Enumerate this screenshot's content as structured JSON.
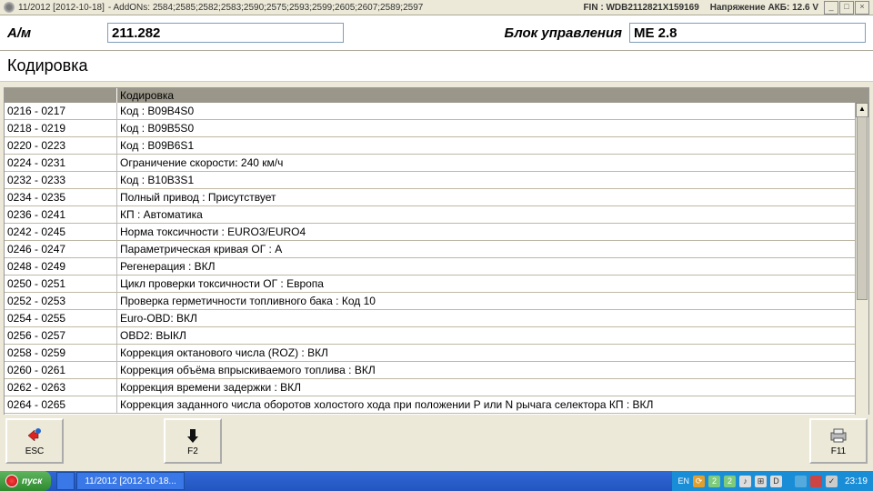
{
  "titlebar": {
    "version": "11/2012 [2012-10-18]",
    "addons": "- AddONs: 2584;2585;2582;2583;2590;2575;2593;2599;2605;2607;2589;2597",
    "finlabel": "FIN :",
    "fin": "WDB2112821X159169",
    "voltlabel": "Напряжение АКБ:",
    "volt": "12.6 V"
  },
  "header": {
    "amlabel": "А/м",
    "am": "211.282",
    "eculabel": "Блок управления",
    "ecu": "ME 2.8"
  },
  "subtitle": "Кодировка",
  "cols": {
    "c1": "",
    "c2": "Кодировка"
  },
  "rows": [
    {
      "id": "0216 - 0217",
      "val": "Код : B09B4S0"
    },
    {
      "id": "0218 - 0219",
      "val": "Код : B09B5S0"
    },
    {
      "id": "0220 - 0223",
      "val": "Код : B09B6S1"
    },
    {
      "id": "0224 - 0231",
      "val": "Ограничение скорости: 240 км/ч"
    },
    {
      "id": "0232 - 0233",
      "val": "Код : B10B3S1"
    },
    {
      "id": "0234 - 0235",
      "val": "Полный привод : Присутствует"
    },
    {
      "id": "0236 - 0241",
      "val": "КП : Автоматика"
    },
    {
      "id": "0242 - 0245",
      "val": "Норма токсичности : EURO3/EURO4"
    },
    {
      "id": "0246 - 0247",
      "val": "Параметрическая кривая ОГ : A"
    },
    {
      "id": "0248 - 0249",
      "val": "Регенерация : ВКЛ"
    },
    {
      "id": "0250 - 0251",
      "val": "Цикл проверки токсичности ОГ : Европа"
    },
    {
      "id": "0252 - 0253",
      "val": "Проверка герметичности топливного бака : Код 10"
    },
    {
      "id": "0254 - 0255",
      "val": "Euro-OBD: ВКЛ"
    },
    {
      "id": "0256 - 0257",
      "val": "OBD2: ВЫКЛ"
    },
    {
      "id": "0258 - 0259",
      "val": "Коррекция октанового числа (ROZ) : ВКЛ"
    },
    {
      "id": "0260 - 0261",
      "val": "Коррекция объёма впрыскиваемого топлива : ВКЛ"
    },
    {
      "id": "0262 - 0263",
      "val": "Коррекция времени задержки : ВКЛ"
    },
    {
      "id": "0264 - 0265",
      "val": "Коррекция заданного числа оборотов холостого хода при положении P или N рычага селектора КП : ВКЛ"
    }
  ],
  "fkeys": {
    "esc": "ESC",
    "f2": "F2",
    "f11": "F11"
  },
  "taskbar": {
    "start": "пуск",
    "tasks": [
      "",
      "11/2012 [2012-10-18..."
    ],
    "lang": "EN",
    "clock": "23:19"
  }
}
